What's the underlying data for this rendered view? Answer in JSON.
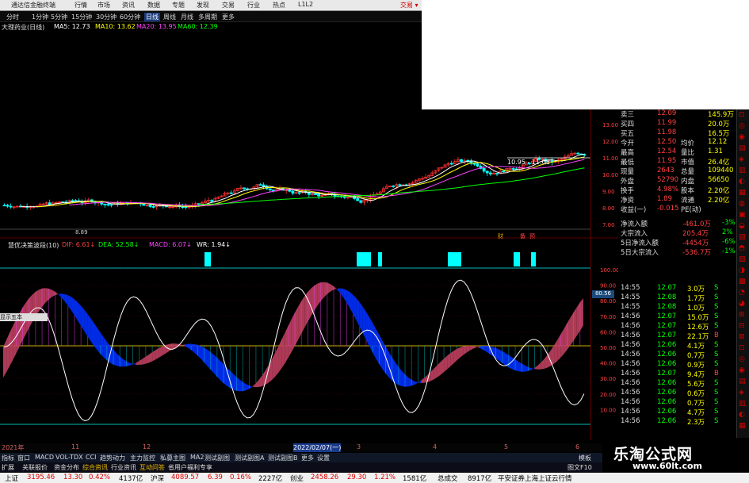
{
  "app": {
    "title": "通达信金融终端",
    "menu": [
      "行情",
      "市场",
      "资讯",
      "数据",
      "专题",
      "发现",
      "交易",
      "行业",
      "热点",
      "L1L2"
    ],
    "trade_label": "交易 ▾"
  },
  "period_tabs": [
    "分时",
    "1分钟",
    "5分钟",
    "15分钟",
    "30分钟",
    "60分钟",
    "日线",
    "周线",
    "月线",
    "多周期",
    "更多"
  ],
  "active_period": "日线",
  "stock": {
    "name": "大理药业(日线)",
    "ma": [
      {
        "label": "MA5: 12.73",
        "color": "#ffffff"
      },
      {
        "label": "MA10: 13.62",
        "color": "#ffff00"
      },
      {
        "label": "MA20: 13.95",
        "color": "#ff40ff"
      },
      {
        "label": "MA60: 12.39",
        "color": "#00ff00"
      }
    ]
  },
  "price_axis": [
    "13.00",
    "12.00",
    "11.00",
    "10.00",
    "9.00",
    "8.00",
    "7.00"
  ],
  "indicator_axis": [
    "100.00",
    "90.00",
    "80.00",
    "70.00",
    "60.00",
    "50.00",
    "40.00",
    "30.00",
    "20.00",
    "10.00"
  ],
  "annotation": "10.95 - 11.08",
  "cursor_label": "显示五本",
  "price_cursor": "80.56",
  "low_marker": "8.89",
  "chart_markers": [
    "财",
    "备",
    "预"
  ],
  "indicator": {
    "name": "慧优决策波段(10)",
    "items": [
      {
        "label": "DIF: 6.61↓",
        "color": "#ff4040"
      },
      {
        "label": "DEA: 52.58↓",
        "color": "#00ff00"
      },
      {
        "label": "MACD: 6.07↓",
        "color": "#ff40ff"
      },
      {
        "label": "WR: 1.94↓",
        "color": "#ffffff"
      }
    ]
  },
  "quote": {
    "rows": [
      {
        "l": "卖三",
        "v": "12.09",
        "v2": "",
        "v3": "145.9万"
      },
      {
        "l": "买四",
        "v": "11.99",
        "v2": "",
        "v3": "20.0万"
      },
      {
        "l": "买五",
        "v": "11.98",
        "v2": "",
        "v3": "16.5万"
      },
      {
        "l": "今开",
        "v": "12.50",
        "v2": "均价",
        "v3": "12.12"
      },
      {
        "l": "最高",
        "v": "12.54",
        "v2": "量比",
        "v3": "1.31"
      },
      {
        "l": "最低",
        "v": "11.95",
        "v2": "市值",
        "v3": "26.4亿"
      },
      {
        "l": "现量",
        "v": "2643",
        "v2": "总量",
        "v3": "109440"
      },
      {
        "l": "外盘",
        "v": "52790",
        "v2": "内盘",
        "v3": "56650"
      },
      {
        "l": "换手",
        "v": "4.98%",
        "v2": "股本",
        "v3": "2.20亿"
      },
      {
        "l": "净资",
        "v": "1.89",
        "v2": "流通",
        "v3": "2.20亿"
      },
      {
        "l": "收益(一)",
        "v": "-0.015",
        "v2": "PE(动)",
        "v3": ""
      }
    ],
    "flows": [
      {
        "l": "净流入额",
        "v": "-461.0万",
        "p": "-3%"
      },
      {
        "l": "大宗流入",
        "v": "205.4万",
        "p": "2%"
      },
      {
        "l": "5日净流入额",
        "v": "-4454万",
        "p": "-6%"
      },
      {
        "l": "5日大宗流入",
        "v": "-536.7万",
        "p": "-1%"
      }
    ]
  },
  "trades": [
    {
      "t": "14:55",
      "p": "12.07",
      "v": "3.0万",
      "s": "S"
    },
    {
      "t": "14:55",
      "p": "12.08",
      "v": "1.7万",
      "s": "S"
    },
    {
      "t": "14:55",
      "p": "12.08",
      "v": "1.0万",
      "s": "S"
    },
    {
      "t": "14:56",
      "p": "12.07",
      "v": "15.0万",
      "s": "S"
    },
    {
      "t": "14:56",
      "p": "12.07",
      "v": "12.6万",
      "s": "S"
    },
    {
      "t": "14:56",
      "p": "12.07",
      "v": "22.1万",
      "s": "B"
    },
    {
      "t": "14:56",
      "p": "12.06",
      "v": "4.1万",
      "s": "S"
    },
    {
      "t": "14:56",
      "p": "12.06",
      "v": "0.7万",
      "s": "S"
    },
    {
      "t": "14:56",
      "p": "12.06",
      "v": "0.9万",
      "s": "S"
    },
    {
      "t": "14:56",
      "p": "12.07",
      "v": "9.4万",
      "s": "B"
    },
    {
      "t": "14:56",
      "p": "12.06",
      "v": "5.6万",
      "s": "S"
    },
    {
      "t": "14:56",
      "p": "12.06",
      "v": "0.6万",
      "s": "S"
    },
    {
      "t": "14:56",
      "p": "12.06",
      "v": "0.7万",
      "s": "S"
    },
    {
      "t": "14:56",
      "p": "12.06",
      "v": "4.7万",
      "s": "S"
    },
    {
      "t": "14:56",
      "p": "12.06",
      "v": "2.3万",
      "s": "S"
    }
  ],
  "dates": [
    "2021年",
    "11",
    "12",
    "2022/02/07(一)",
    "3",
    "4",
    "5",
    "6"
  ],
  "tabs": [
    "指标",
    "窗口",
    "MACD",
    "VOL-TDX",
    "CCI",
    "趋势动力",
    "主力监控",
    "私募主图",
    "MA2",
    "测试副图",
    "测试副图A",
    "测试副图B",
    "更多",
    "设置"
  ],
  "tabs2": [
    "扩展",
    "关联报价",
    "资金分布",
    "综合资讯",
    "行业资讯",
    "互动问答",
    "省用户福利专享"
  ],
  "tab_right": [
    "模板",
    "图文F10"
  ],
  "ticker": [
    {
      "l": "上证",
      "v": "3195.46",
      "c": "13.30",
      "p": "0.42%",
      "a": "4137亿"
    },
    {
      "l": "沪深",
      "v": "4089.57",
      "c": "6.39",
      "p": "0.16%",
      "a": "2227亿"
    },
    {
      "l": "创业",
      "v": "2458.26",
      "c": "29.30",
      "p": "1.21%",
      "a": "1581亿"
    },
    {
      "l": "总成交",
      "v": "8917亿",
      "c": "",
      "p": "",
      "a": ""
    }
  ],
  "ticker_msg": "平安证券上海上证云行情",
  "brand": {
    "name": "乐淘公式网",
    "url": "www.60lt.com"
  },
  "colors": {
    "up": "#ff3030",
    "down": "#00ffff",
    "ma5": "#ffffff",
    "ma10": "#ffff00",
    "ma20": "#ff40ff",
    "ma60": "#00ff00",
    "band_blue": "#0030ff",
    "band_red": "#c04060"
  }
}
